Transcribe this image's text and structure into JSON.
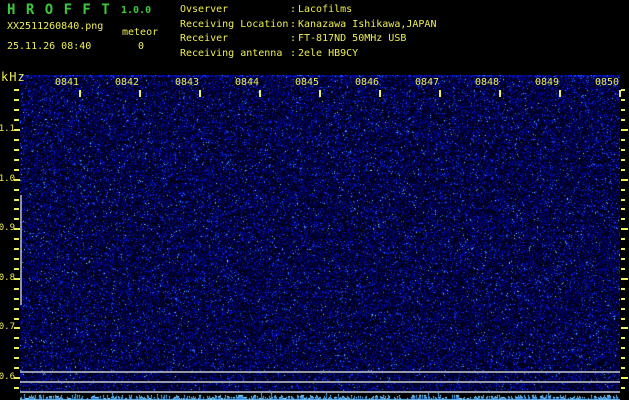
{
  "app": {
    "title": "H R O F F T",
    "version": "1.0.0"
  },
  "header": {
    "filename": "XX2511260840.png",
    "mode": "meteor",
    "datetime": "25.11.26 08:40",
    "meteor_count": "0",
    "info_rows": [
      {
        "label": "Ovserver",
        "sep": ":",
        "value": "Lacofilms"
      },
      {
        "label": "Receiving Location",
        "sep": ":",
        "value": "Kanazawa Ishikawa,JAPAN"
      },
      {
        "label": "Receiver",
        "sep": ":",
        "value": "FT-817ND 50MHz USB"
      },
      {
        "label": "Receiving antenna",
        "sep": ":",
        "value": "2ele HB9CY"
      }
    ]
  },
  "spectrogram": {
    "freq_unit": "kHz",
    "freq_tick_labels": [
      "1.1",
      "1.0",
      "0.9",
      "0.8",
      "0.7",
      "0.6"
    ],
    "time_tick_labels": [
      "0841",
      "0842",
      "0843",
      "0844",
      "0845",
      "0846",
      "0847",
      "0848",
      "0849",
      "0850"
    ]
  },
  "colors": {
    "background": "#000000",
    "title_green": "#3cc83c",
    "label_yellow": "#eeee55",
    "grid_gray": "#a9aeb6",
    "noise_dim_blue": "#000080",
    "noise_bright_blue": "#4f7fff",
    "noise_cyan_speck": "#9fe8ff",
    "level_strip_cyan": "#8fe0ff"
  },
  "chart_data": {
    "type": "heatmap",
    "title": "HROFFT 1.0.0 radio meteor observation spectrogram",
    "x_ticks": [
      "0841",
      "0842",
      "0843",
      "0844",
      "0845",
      "0846",
      "0847",
      "0848",
      "0849",
      "0850"
    ],
    "x_unit": "time hhmm (25.11.26 08:40 start, 1 min/div)",
    "y_ticks": [
      1.1,
      1.0,
      0.9,
      0.8,
      0.7,
      0.6
    ],
    "y_unit": "kHz",
    "y_range": [
      0.57,
      1.21
    ],
    "meteor_echo_count": 0,
    "content": "uniform dark-blue background noise, no meteor echoes",
    "horizontal_carrier_lines_khz": [
      0.61,
      0.59,
      0.57
    ],
    "bottom_strip": "cyan signal-level trace along bottom edge",
    "legend": "none",
    "grid": "off"
  }
}
